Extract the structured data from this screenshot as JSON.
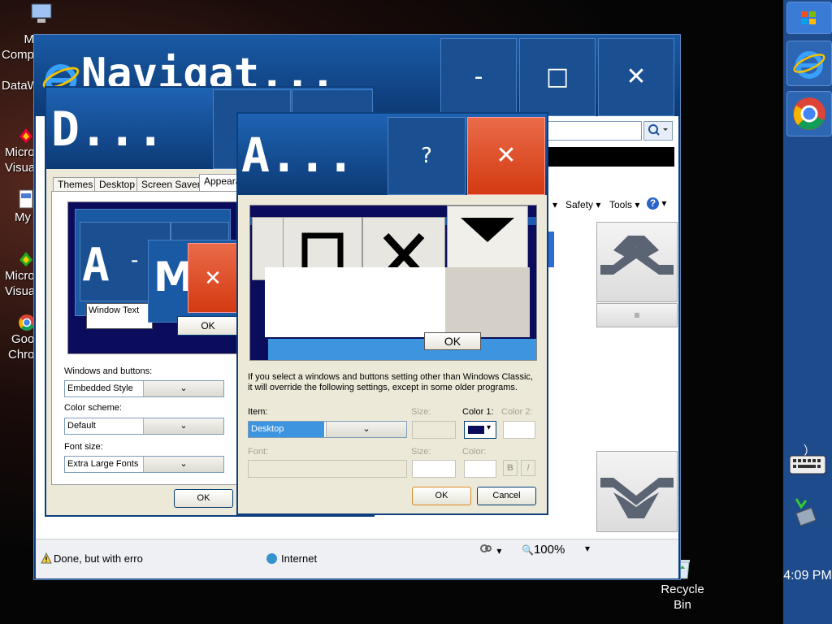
{
  "desktop": {
    "icons": [
      {
        "label_a": "M",
        "label_b": "Comp",
        "name": "my-computer"
      },
      {
        "label_a": "DataW",
        "label_b": "",
        "name": "dataw"
      },
      {
        "label_a": "Micro",
        "label_b": "Visua",
        "name": "visual-1"
      },
      {
        "label_a": "My",
        "label_b": "",
        "name": "my-docs"
      },
      {
        "label_a": "Micro",
        "label_b": "Visua",
        "name": "visual-2"
      },
      {
        "label_a": "Goo",
        "label_b": "Chro",
        "name": "chrome"
      }
    ],
    "recycle_bin": {
      "line1": "Recycle",
      "line2": "Bin"
    }
  },
  "taskbar": {
    "clock": "4:09 PM"
  },
  "ie": {
    "title": "Navigat...",
    "title_prefix": "e",
    "min": "-",
    "max": "□",
    "close": "✕",
    "search_icon": "search-icon",
    "menu": {
      "safety": "Safety",
      "tools": "Tools",
      "help": "?"
    },
    "status": {
      "text": "Done, but with erro",
      "zone": "Internet",
      "zoom": "100%"
    },
    "scroll_up": "scroll-up-icon",
    "scroll_down": "scroll-down-icon",
    "scroll_grip": "≡"
  },
  "display": {
    "title": "D...",
    "tabs": [
      "Themes",
      "Desktop",
      "Screen Saver",
      "Appeara"
    ],
    "preview": {
      "caption_a": "A",
      "caption_m": "M",
      "window_text": "Window Text",
      "ok": "OK",
      "close": "✕",
      "min": "-"
    },
    "windows_label": "Windows and buttons:",
    "windows_value": "Embedded Style",
    "scheme_label": "Color scheme:",
    "scheme_value": "Default",
    "font_label": "Font size:",
    "font_value": "Extra Large Fonts",
    "ok": "OK"
  },
  "advanced": {
    "title": "A...",
    "help": "?",
    "close": "✕",
    "preview_ok": "OK",
    "note": "If you select a windows and buttons setting other than Windows Classic, it will override the following settings, except in some older programs.",
    "item_label": "Item:",
    "item_value": "Desktop",
    "size_label": "Size:",
    "color1_label": "Color 1:",
    "color2_label": "Color 2:",
    "font_label": "Font:",
    "size2_label": "Size:",
    "color_label": "Color:",
    "bold": "B",
    "italic": "I",
    "ok": "OK",
    "cancel": "Cancel"
  },
  "colors": {
    "xp_blue": "#0e3f7c",
    "close_red": "#e2471f",
    "desktop_color": "#0c0c5c",
    "selection": "#3d95e0"
  }
}
